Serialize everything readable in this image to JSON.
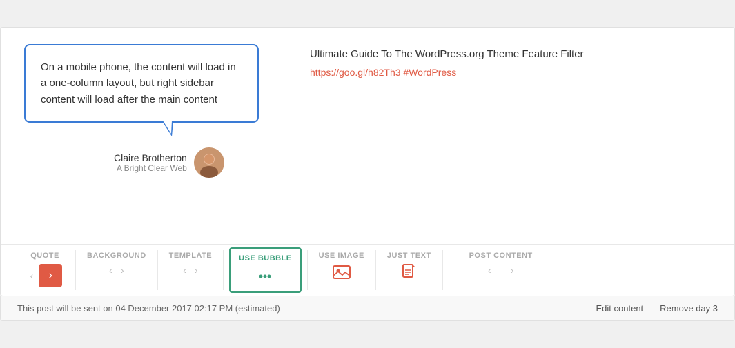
{
  "card": {
    "bubble_text": "On a mobile phone, the content will load in a one-column layout, but right sidebar content will load after the main content",
    "author_name": "Claire Brotherton",
    "author_subtitle": "A Bright Clear Web",
    "post_title": "Ultimate Guide To The WordPress.org Theme Feature Filter",
    "post_link": "https://goo.gl/h82Th3 #WordPress"
  },
  "toolbar": {
    "quote_label": "QUOTE",
    "background_label": "BACKGROUND",
    "template_label": "TEMPLATE",
    "use_bubble_label": "USE BUBBLE",
    "use_image_label": "USE IMAGE",
    "just_text_label": "JUST TEXT",
    "post_content_label": "POST CONTENT"
  },
  "footer": {
    "status_text": "This post will be sent on 04 December 2017 02:17 PM (estimated)",
    "edit_content_label": "Edit content",
    "remove_day_label": "Remove day 3"
  },
  "icons": {
    "chevron_left": "‹",
    "chevron_right": "›",
    "arrow_right": "›",
    "bubble_icon": "💬",
    "image_icon": "🖼",
    "document_icon": "📄"
  }
}
